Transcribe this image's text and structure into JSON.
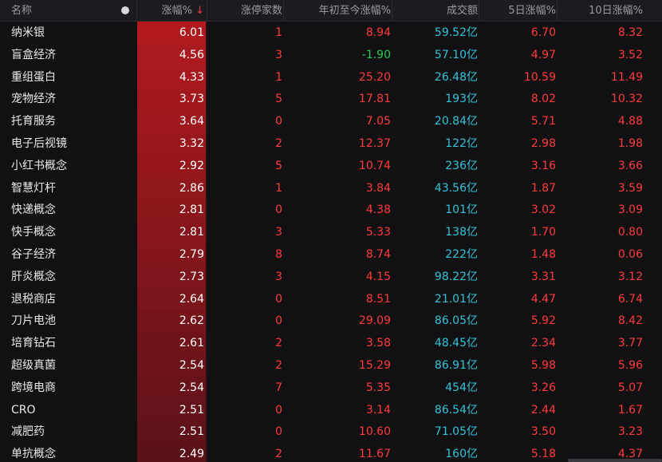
{
  "colors": {
    "header_bg": "#1c1c20",
    "bg": "#111114",
    "up": "#ff3b3b",
    "down": "#2fc957",
    "volume": "#34c3d8",
    "bar_top": "#b01a1e",
    "bar_bottom": "#5a1218"
  },
  "header": {
    "name": "名称",
    "pct": "涨幅%",
    "sort_arrow": "↓",
    "limit_up": "涨停家数",
    "ytd": "年初至今涨幅%",
    "volume": "成交额",
    "d5": "5日涨幅%",
    "d10": "10日涨幅%"
  },
  "rows": [
    {
      "name": "纳米银",
      "pct": "6.01",
      "cnt": "1",
      "ytd": "8.94",
      "vol": "59.52亿",
      "d5": "6.70",
      "d10": "8.32"
    },
    {
      "name": "盲盒经济",
      "pct": "4.56",
      "cnt": "3",
      "ytd": "-1.90",
      "vol": "57.10亿",
      "d5": "4.97",
      "d10": "3.52"
    },
    {
      "name": "重组蛋白",
      "pct": "4.33",
      "cnt": "1",
      "ytd": "25.20",
      "vol": "26.48亿",
      "d5": "10.59",
      "d10": "11.49"
    },
    {
      "name": "宠物经济",
      "pct": "3.73",
      "cnt": "5",
      "ytd": "17.81",
      "vol": "193亿",
      "d5": "8.02",
      "d10": "10.32"
    },
    {
      "name": "托育服务",
      "pct": "3.64",
      "cnt": "0",
      "ytd": "7.05",
      "vol": "20.84亿",
      "d5": "5.71",
      "d10": "4.88"
    },
    {
      "name": "电子后视镜",
      "pct": "3.32",
      "cnt": "2",
      "ytd": "12.37",
      "vol": "122亿",
      "d5": "2.98",
      "d10": "1.98"
    },
    {
      "name": "小红书概念",
      "pct": "2.92",
      "cnt": "5",
      "ytd": "10.74",
      "vol": "236亿",
      "d5": "3.16",
      "d10": "3.66"
    },
    {
      "name": "智慧灯杆",
      "pct": "2.86",
      "cnt": "1",
      "ytd": "3.84",
      "vol": "43.56亿",
      "d5": "1.87",
      "d10": "3.59"
    },
    {
      "name": "快递概念",
      "pct": "2.81",
      "cnt": "0",
      "ytd": "4.38",
      "vol": "101亿",
      "d5": "3.02",
      "d10": "3.09"
    },
    {
      "name": "快手概念",
      "pct": "2.81",
      "cnt": "3",
      "ytd": "5.33",
      "vol": "138亿",
      "d5": "1.70",
      "d10": "0.80"
    },
    {
      "name": "谷子经济",
      "pct": "2.79",
      "cnt": "8",
      "ytd": "8.74",
      "vol": "222亿",
      "d5": "1.48",
      "d10": "0.06"
    },
    {
      "name": "肝炎概念",
      "pct": "2.73",
      "cnt": "3",
      "ytd": "4.15",
      "vol": "98.22亿",
      "d5": "3.31",
      "d10": "3.12"
    },
    {
      "name": "退税商店",
      "pct": "2.64",
      "cnt": "0",
      "ytd": "8.51",
      "vol": "21.01亿",
      "d5": "4.47",
      "d10": "6.74"
    },
    {
      "name": "刀片电池",
      "pct": "2.62",
      "cnt": "0",
      "ytd": "29.09",
      "vol": "86.05亿",
      "d5": "5.92",
      "d10": "8.42"
    },
    {
      "name": "培育钻石",
      "pct": "2.61",
      "cnt": "2",
      "ytd": "3.58",
      "vol": "48.45亿",
      "d5": "2.34",
      "d10": "3.77"
    },
    {
      "name": "超级真菌",
      "pct": "2.54",
      "cnt": "2",
      "ytd": "15.29",
      "vol": "86.91亿",
      "d5": "5.98",
      "d10": "5.96"
    },
    {
      "name": "跨境电商",
      "pct": "2.54",
      "cnt": "7",
      "ytd": "5.35",
      "vol": "454亿",
      "d5": "3.26",
      "d10": "5.07"
    },
    {
      "name": "CRO",
      "pct": "2.51",
      "cnt": "0",
      "ytd": "3.14",
      "vol": "86.54亿",
      "d5": "2.44",
      "d10": "1.67"
    },
    {
      "name": "减肥药",
      "pct": "2.51",
      "cnt": "0",
      "ytd": "10.60",
      "vol": "71.05亿",
      "d5": "3.50",
      "d10": "3.23"
    },
    {
      "name": "单抗概念",
      "pct": "2.49",
      "cnt": "2",
      "ytd": "11.67",
      "vol": "160亿",
      "d5": "5.18",
      "d10": "4.37"
    }
  ]
}
